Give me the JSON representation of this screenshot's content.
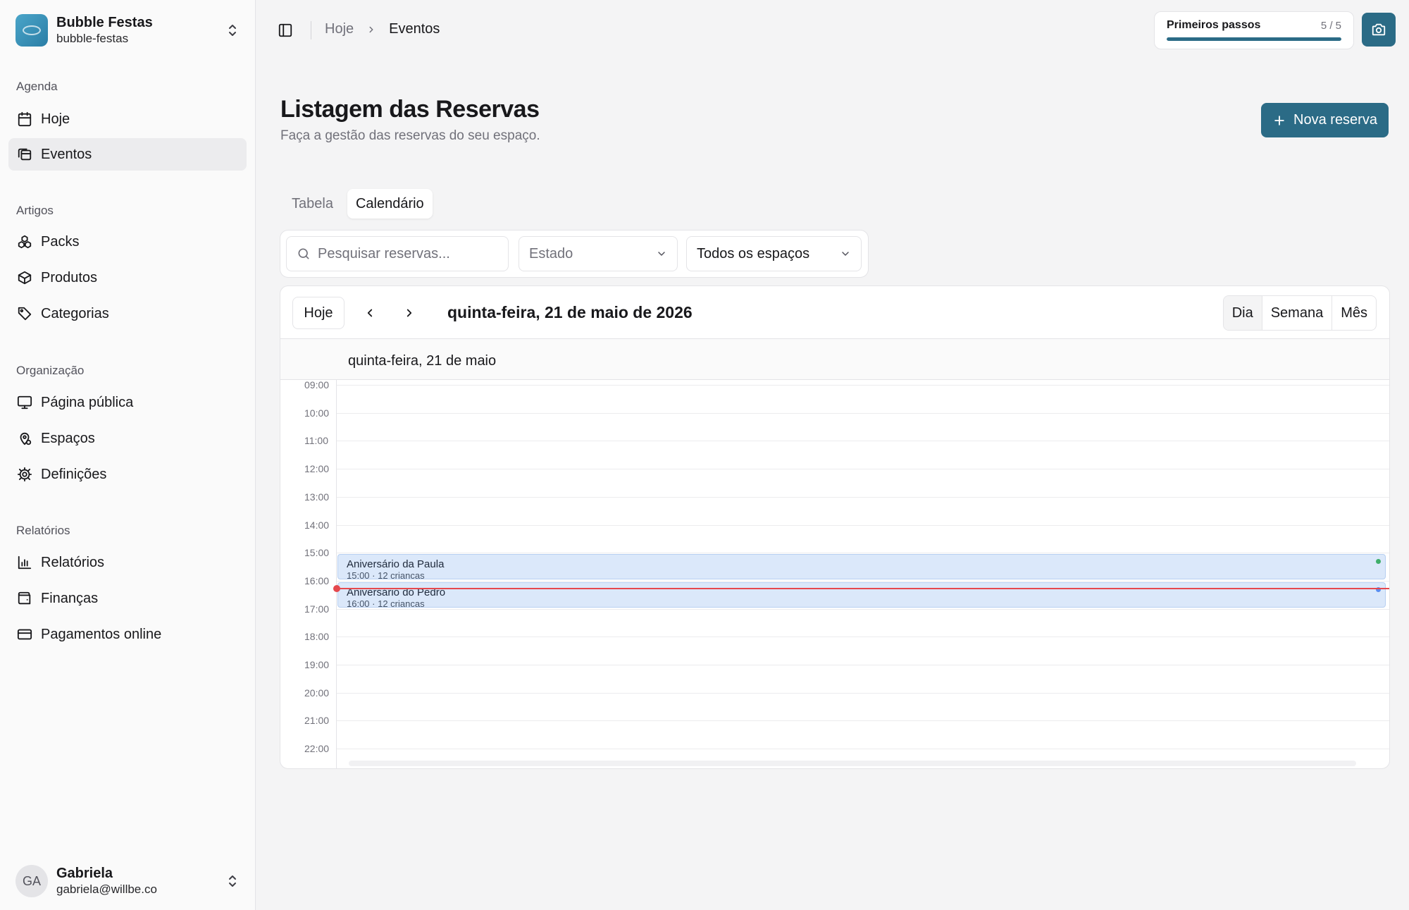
{
  "org": {
    "name": "Bubble Festas",
    "slug": "bubble-festas"
  },
  "sidebar": {
    "groups": [
      {
        "label": "Agenda",
        "items": [
          {
            "label": "Hoje",
            "icon": "calendar-icon"
          },
          {
            "label": "Eventos",
            "icon": "events-icon",
            "active": true
          }
        ]
      },
      {
        "label": "Artigos",
        "items": [
          {
            "label": "Packs",
            "icon": "packs-icon"
          },
          {
            "label": "Produtos",
            "icon": "box-icon"
          },
          {
            "label": "Categorias",
            "icon": "tag-icon"
          }
        ]
      },
      {
        "label": "Organização",
        "items": [
          {
            "label": "Página pública",
            "icon": "monitor-icon"
          },
          {
            "label": "Espaços",
            "icon": "map-pin-icon"
          },
          {
            "label": "Definições",
            "icon": "gear-icon"
          }
        ]
      },
      {
        "label": "Relatórios",
        "items": [
          {
            "label": "Relatórios",
            "icon": "bar-chart-icon"
          },
          {
            "label": "Finanças",
            "icon": "wallet-icon"
          },
          {
            "label": "Pagamentos online",
            "icon": "credit-card-icon"
          }
        ]
      }
    ]
  },
  "user": {
    "initials": "GA",
    "name": "Gabriela",
    "email": "gabriela@willbe.co"
  },
  "header": {
    "breadcrumb": {
      "parent": "Hoje",
      "current": "Eventos"
    },
    "steps": {
      "label": "Primeiros passos",
      "count": "5 / 5",
      "progress": 1.0
    }
  },
  "page": {
    "title": "Listagem das Reservas",
    "subtitle": "Faça a gestão das reservas do seu espaço.",
    "new_button": "Nova reserva"
  },
  "tabs": [
    {
      "label": "Tabela",
      "active": false
    },
    {
      "label": "Calendário",
      "active": true
    }
  ],
  "filters": {
    "search_placeholder": "Pesquisar reservas...",
    "estado": "Estado",
    "espacos": "Todos os espaços"
  },
  "calendar": {
    "today_button": "Hoje",
    "current_date": "quinta-feira, 21 de maio de 2026",
    "views": [
      {
        "label": "Dia",
        "active": true
      },
      {
        "label": "Semana",
        "active": false
      },
      {
        "label": "Mês",
        "active": false
      }
    ],
    "day_label": "quinta-feira, 21 de maio",
    "hours": [
      "09:00",
      "10:00",
      "11:00",
      "12:00",
      "13:00",
      "14:00",
      "15:00",
      "16:00",
      "17:00",
      "18:00",
      "19:00",
      "20:00",
      "21:00",
      "22:00"
    ],
    "events": [
      {
        "title": "Aniversário da Paula",
        "meta": "15:00 · 12 crianças",
        "start_hour": 15.0,
        "dot_color": "#3fae6a"
      },
      {
        "title": "Aniversário do Pedro",
        "meta": "16:00 · 12 crianças",
        "start_hour": 16.0,
        "dot_color": "#5b8def"
      }
    ],
    "now_hour": 16.25
  },
  "colors": {
    "accent": "#2b6b86",
    "now_line": "#e5484d",
    "event_bg": "#dbe8fa"
  }
}
